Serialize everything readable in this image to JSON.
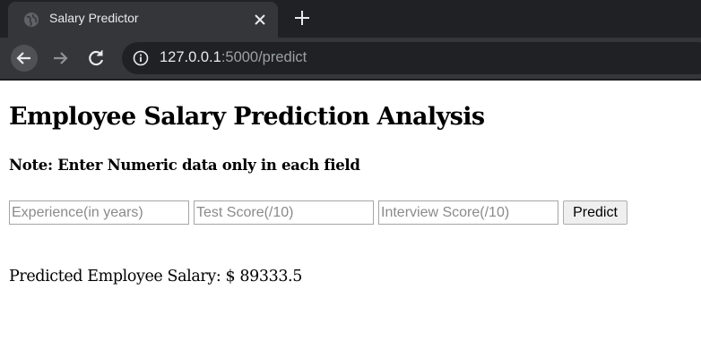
{
  "browser": {
    "tab": {
      "title": "Salary Predictor",
      "favicon": "globe-icon"
    },
    "url": {
      "host": "127.0.0.1",
      "rest": ":5000/predict"
    },
    "colors": {
      "tabstrip": "#202124",
      "toolbar": "#35363a",
      "omnibox": "#202124",
      "text": "#e8eaed"
    }
  },
  "page": {
    "title": "Employee Salary Prediction Analysis",
    "note": "Note: Enter Numeric data only in each field",
    "form": {
      "experience": {
        "placeholder": "Experience(in years)",
        "value": ""
      },
      "test_score": {
        "placeholder": "Test Score(/10)",
        "value": ""
      },
      "interview_score": {
        "placeholder": "Interview Score(/10)",
        "value": ""
      },
      "submit_label": "Predict"
    },
    "result_text": "Predicted Employee Salary: $ 89333.5"
  }
}
